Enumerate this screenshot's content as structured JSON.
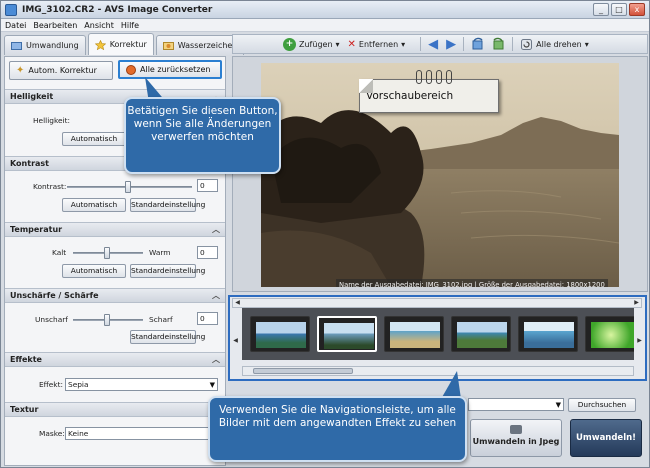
{
  "window": {
    "title": "IMG_3102.CR2 - AVS Image Converter",
    "controls": [
      "_",
      "□",
      "x"
    ]
  },
  "menu": [
    "Datei",
    "Bearbeiten",
    "Ansicht",
    "Hilfe"
  ],
  "tabs": [
    {
      "label": "Umwandlung",
      "active": false
    },
    {
      "label": "Korrektur",
      "active": true
    },
    {
      "label": "Wasserzeichen",
      "active": false
    }
  ],
  "toolbar": {
    "add_label": "Zufügen",
    "remove_label": "Entfernen",
    "rotate_all_label": "Alle drehen"
  },
  "panel": {
    "auto_correct_label": "Autom. Korrektur",
    "reset_all_label": "Alle zurücksetzen",
    "brightness": {
      "header": "Helligkeit",
      "label": "Helligkeit:",
      "auto": "Automatisch"
    },
    "contrast": {
      "header": "Kontrast",
      "label": "Kontrast:",
      "value": "0",
      "auto": "Automatisch",
      "default": "Standardeinstellung"
    },
    "temperature": {
      "header": "Temperatur",
      "left": "Kalt",
      "right": "Warm",
      "value": "0",
      "auto": "Automatisch",
      "default": "Standardeinstellung"
    },
    "sharpness": {
      "header": "Unschärfe / Schärfe",
      "left": "Unscharf",
      "right": "Scharf",
      "value": "0",
      "default": "Standardeinstellung"
    },
    "effects": {
      "header": "Effekte",
      "label": "Effekt:",
      "value": "Sepia"
    },
    "texture": {
      "header": "Textur",
      "label": "Maske:",
      "value": "Keine"
    }
  },
  "preview": {
    "note": "Vorschaubereich",
    "caption": "Name der Ausgabedatei: IMG_3102.jpg | Größe der Ausgabedatei: 1800x1200"
  },
  "bottom": {
    "browse_label": "Durchsuchen",
    "format_label": "Umwandeln in Jpeg",
    "convert_label": "Umwandeln!"
  },
  "callouts": {
    "reset": "Betätigen Sie diesen Button, wenn Sie alle Änderungen verwerfen möchten",
    "nav": "Verwenden Sie die Navigationsleiste, um alle Bilder mit dem angewandten Effekt zu sehen"
  },
  "colors": {
    "accent": "#2f6aa8",
    "sepia": "#b59a73",
    "highlight": "#2b7fd1"
  }
}
